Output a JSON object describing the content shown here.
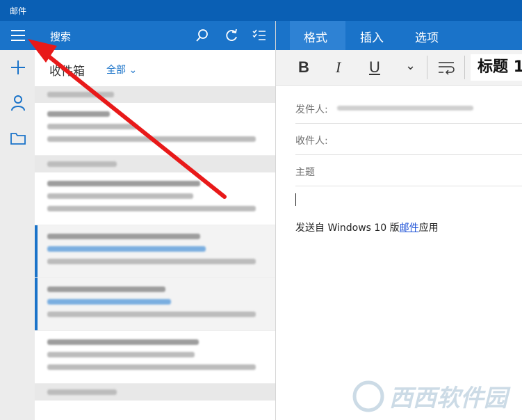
{
  "window": {
    "title": "邮件"
  },
  "search": {
    "label": "搜索"
  },
  "folder": {
    "name": "收件箱",
    "filter": "全部"
  },
  "ribbon": {
    "tabs": [
      "格式",
      "插入",
      "选项"
    ]
  },
  "toolbar": {
    "bold": "B",
    "italic": "I",
    "underline": "U",
    "style": "标题 1"
  },
  "compose": {
    "from_label": "发件人:",
    "to_label": "收件人:",
    "subject_placeholder": "主题",
    "signature_prefix": "发送自  Windows 10  版",
    "signature_link": "邮件",
    "signature_suffix": "应用"
  },
  "watermark": {
    "text": "西西软件园"
  },
  "colors": {
    "accent": "#1a73c9",
    "arrow": "#e81919",
    "titlebar": "#0a5fb4"
  }
}
